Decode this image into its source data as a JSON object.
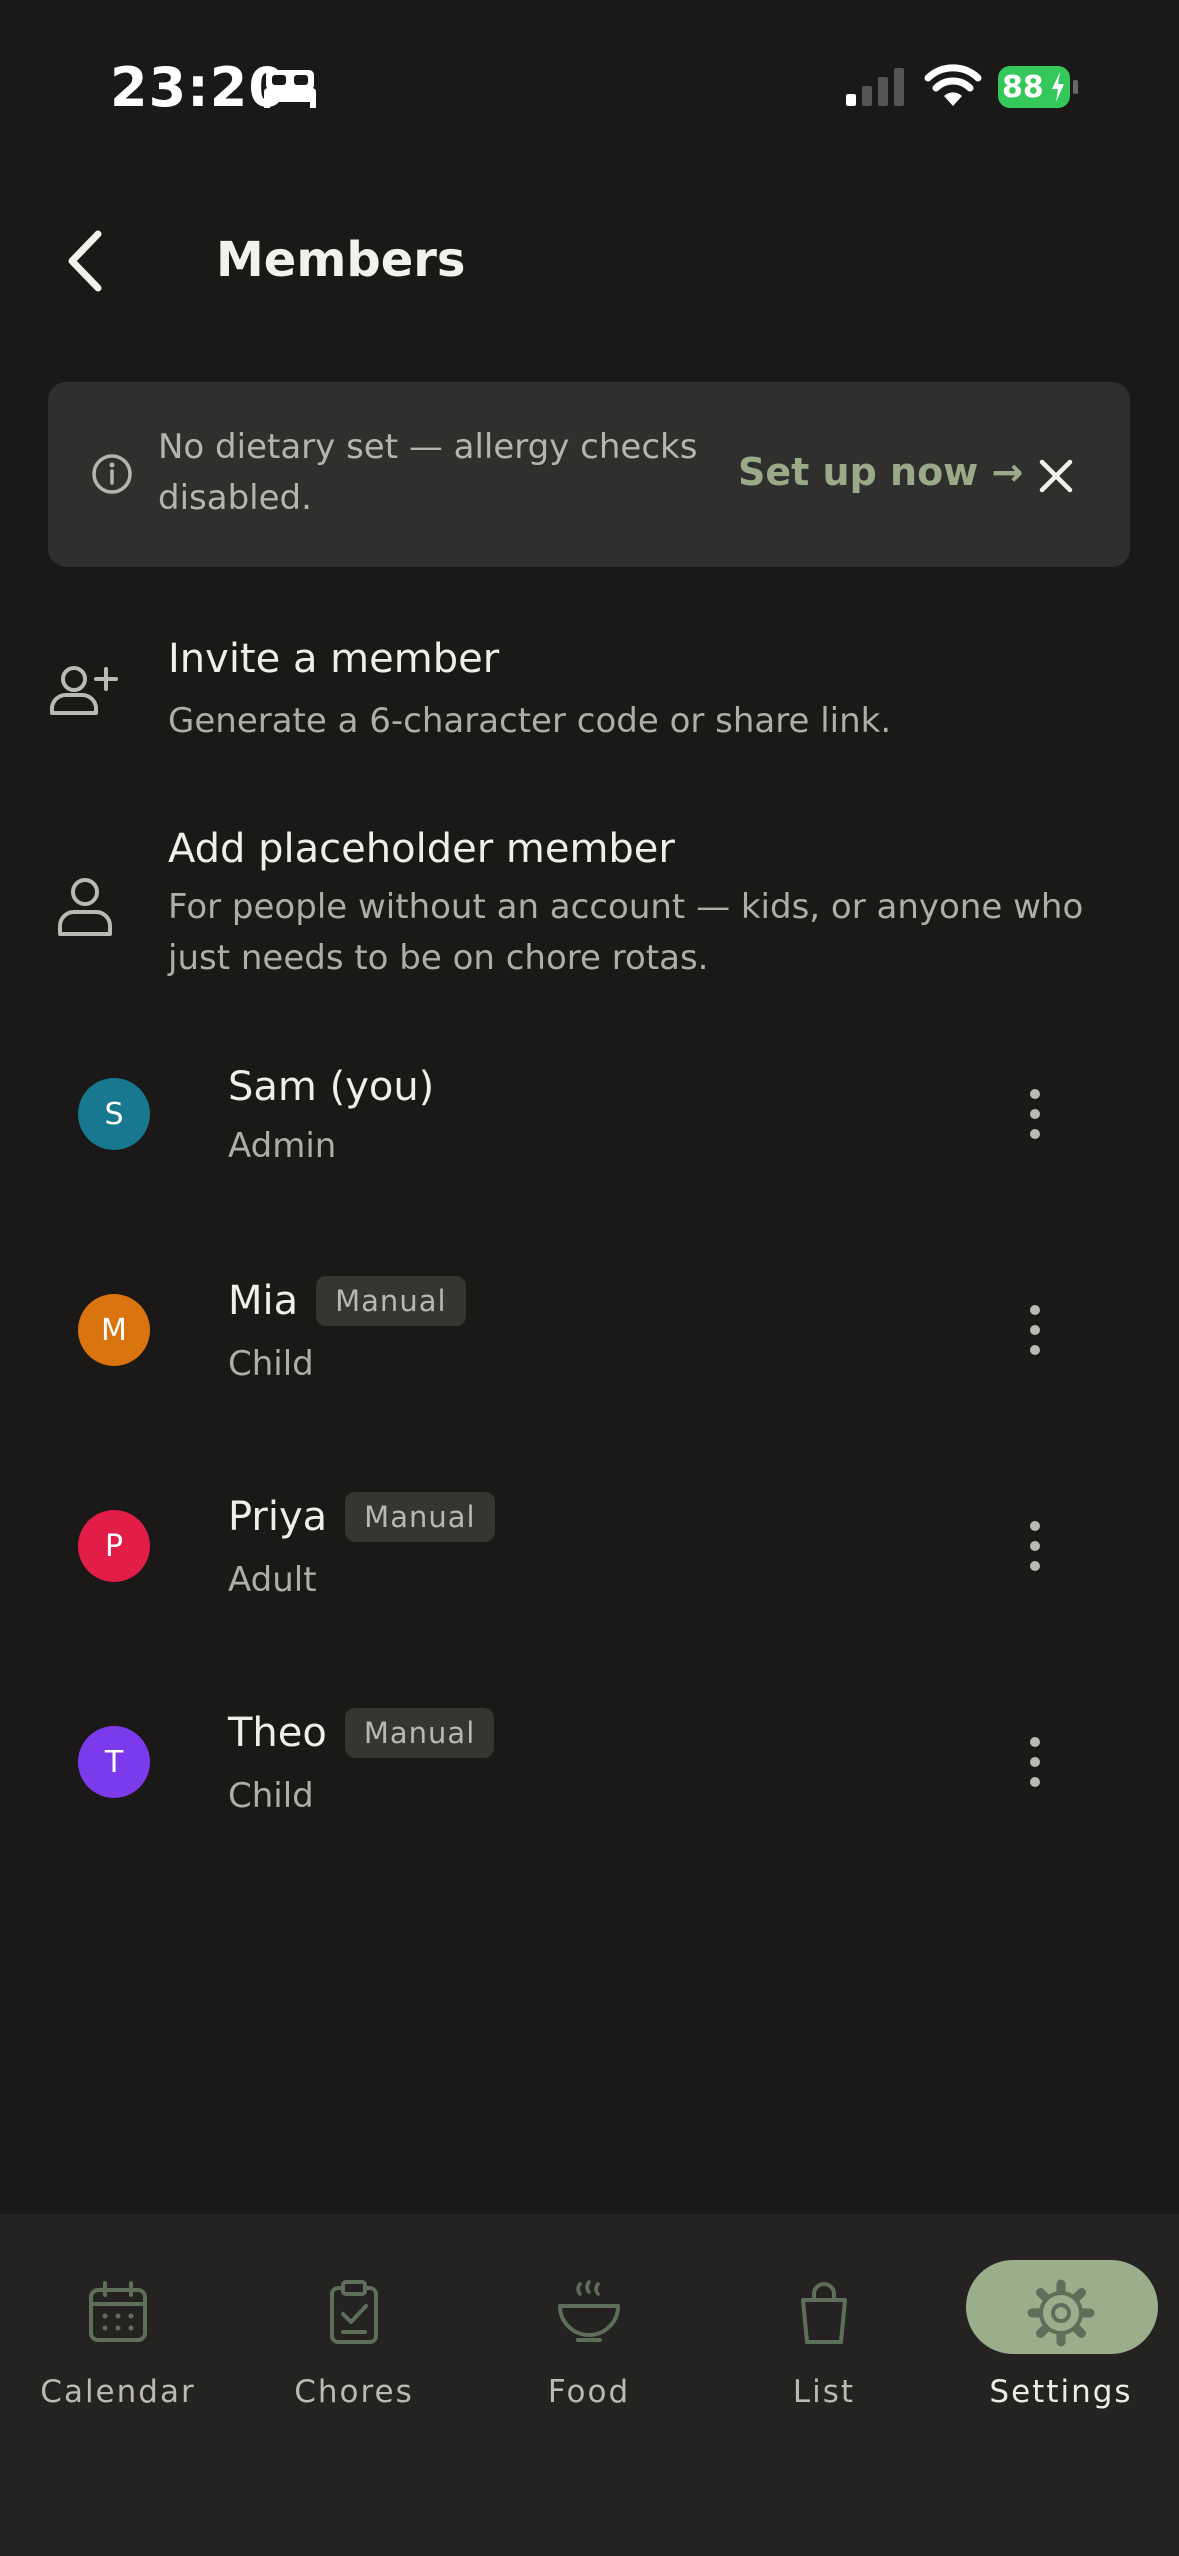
{
  "status_bar": {
    "time": "23:20",
    "battery": "88"
  },
  "header": {
    "title": "Members"
  },
  "banner": {
    "message": "No dietary set — allergy checks disabled.",
    "action": "Set up now →"
  },
  "actions": [
    {
      "title": "Invite a member",
      "subtitle": "Generate a 6-character code or share link."
    },
    {
      "title": "Add placeholder member",
      "subtitle": "For people without an account — kids, or anyone who just needs to be on chore rotas."
    }
  ],
  "members": [
    {
      "initial": "S",
      "name": "Sam (you)",
      "role": "Admin",
      "badge": "",
      "color": "#17788f"
    },
    {
      "initial": "M",
      "name": "Mia",
      "role": "Child",
      "badge": "Manual",
      "color": "#d9740f"
    },
    {
      "initial": "P",
      "name": "Priya",
      "role": "Adult",
      "badge": "Manual",
      "color": "#e11d48"
    },
    {
      "initial": "T",
      "name": "Theo",
      "role": "Child",
      "badge": "Manual",
      "color": "#7c3aed"
    }
  ],
  "nav": [
    {
      "label": "Calendar",
      "icon": "calendar-icon"
    },
    {
      "label": "Chores",
      "icon": "clipboard-check-icon"
    },
    {
      "label": "Food",
      "icon": "bowl-icon"
    },
    {
      "label": "List",
      "icon": "shopping-bag-icon"
    },
    {
      "label": "Settings",
      "icon": "gear-icon",
      "active": true
    }
  ],
  "colors": {
    "accent": "#9bae8c",
    "background": "#1a1917",
    "banner": "#2f302d"
  }
}
